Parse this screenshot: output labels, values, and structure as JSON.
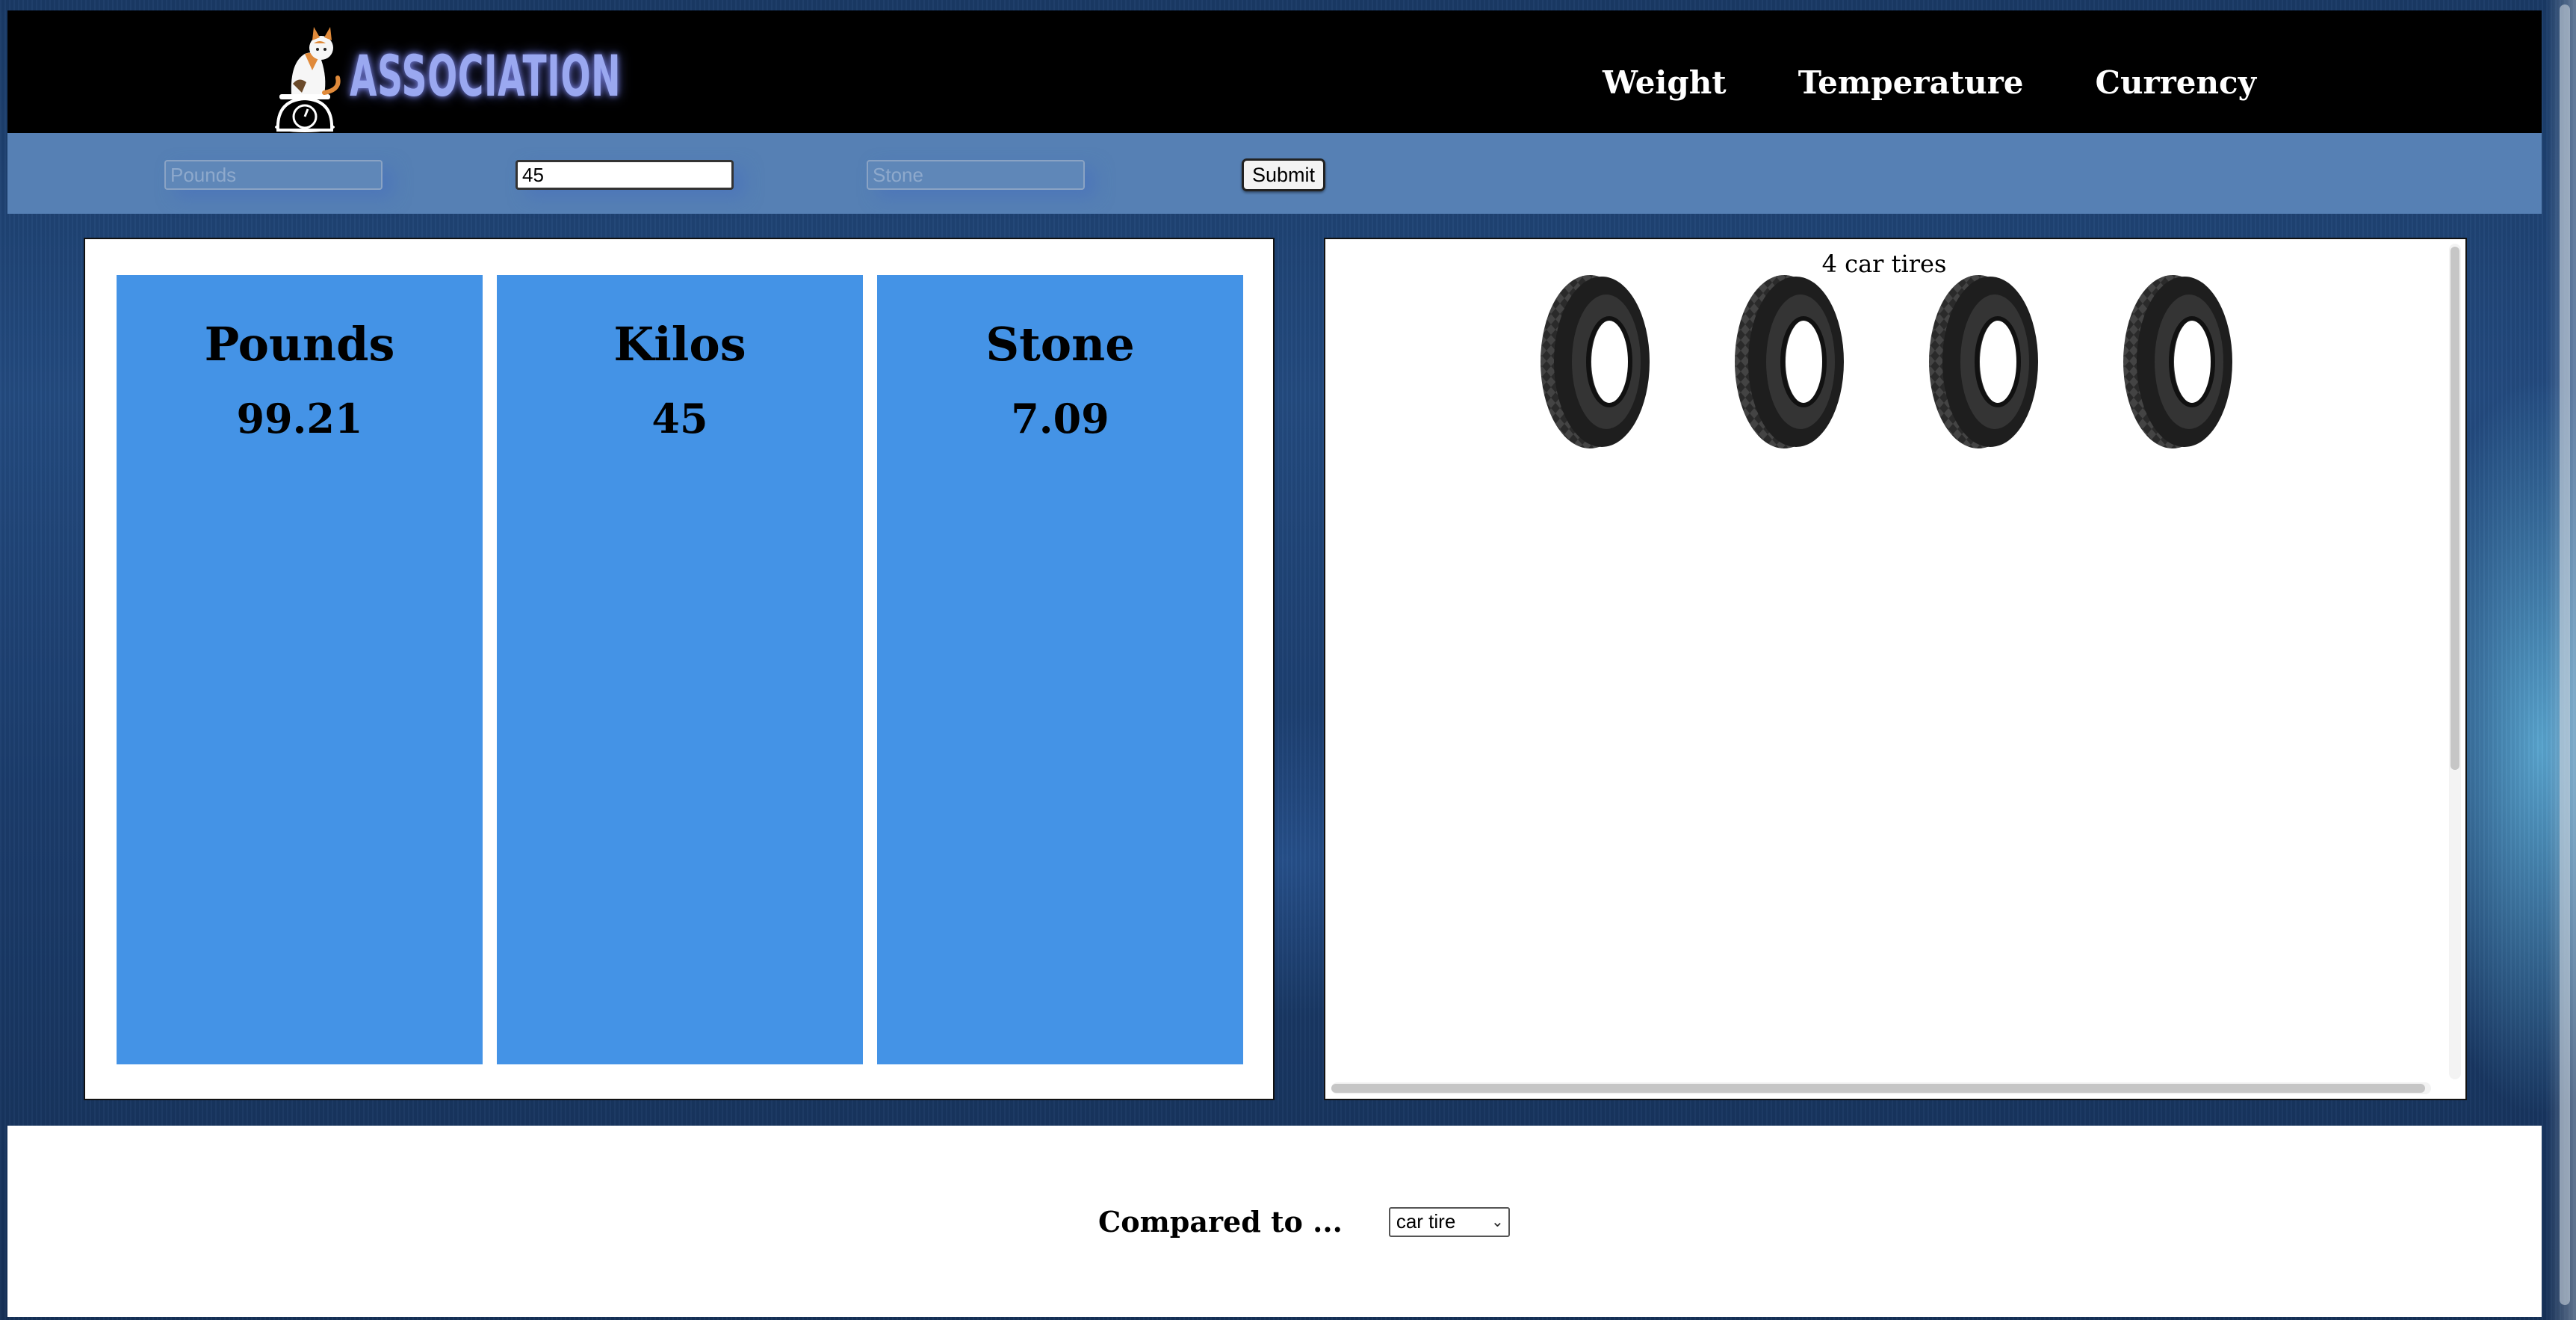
{
  "header": {
    "logo_text": "ASSOCIATION",
    "nav": [
      "Weight",
      "Temperature",
      "Currency"
    ]
  },
  "form": {
    "pounds_placeholder": "Pounds",
    "kilos_value": "45",
    "stone_placeholder": "Stone",
    "submit_label": "Submit"
  },
  "results": [
    {
      "label": "Pounds",
      "value": "99.21"
    },
    {
      "label": "Kilos",
      "value": "45"
    },
    {
      "label": "Stone",
      "value": "7.09"
    }
  ],
  "comparison": {
    "label": "4 car tires",
    "item_icon": "tire-icon",
    "count": 4
  },
  "footer": {
    "compared_label": "Compared to ...",
    "selected_option": "car tire"
  },
  "colors": {
    "accent": "#4493e6",
    "toolbar": "#5680b4",
    "header": "#000000",
    "logo_glow": "#9aa8f0"
  }
}
